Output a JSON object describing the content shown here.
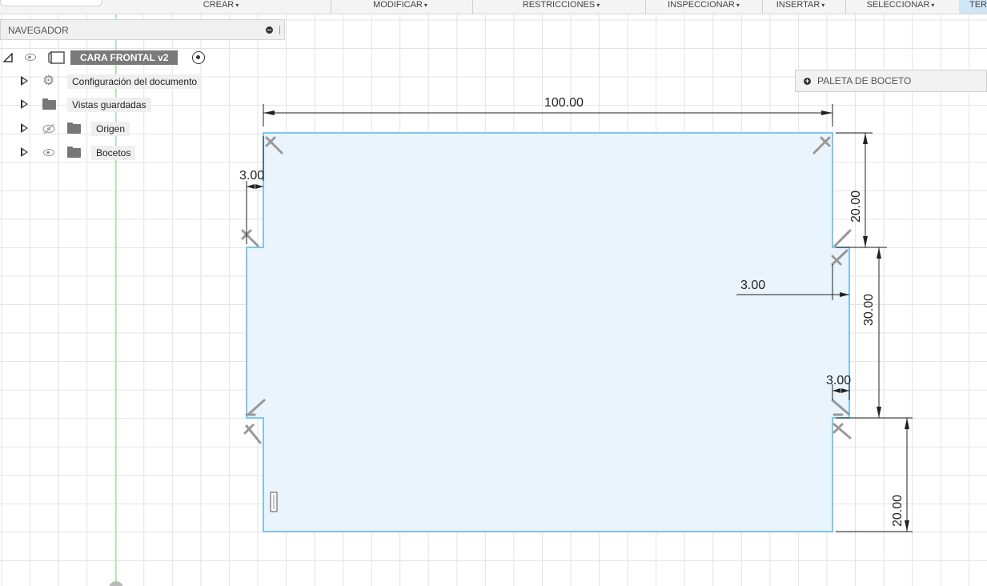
{
  "toolbar": {
    "items": [
      "CREAR",
      "MODIFICAR",
      "RESTRICCIONES",
      "INSPECCIONAR",
      "INSERTAR",
      "SELECCIONAR",
      "TER"
    ],
    "caret": "▾"
  },
  "navigator": {
    "title": "NAVEGADOR",
    "root": {
      "label": "CARA FRONTAL v2"
    },
    "items": [
      {
        "label": "Configuración del documento",
        "icon": "gear-icon"
      },
      {
        "label": "Vistas guardadas",
        "icon": "folder-icon"
      },
      {
        "label": "Origen",
        "icon": "folder-icon",
        "visible": false
      },
      {
        "label": "Bocetos",
        "icon": "folder-icon",
        "visible": true
      }
    ]
  },
  "palette": {
    "label": "PALETA DE BOCETO"
  },
  "dimensions": {
    "width": "100.00",
    "top_right": "20.00",
    "middle_right": "30.00",
    "bottom_right": "20.00",
    "left_notch": "3.00",
    "right_inner": "3.00",
    "right_notch": "3.00"
  },
  "colors": {
    "sketch_fill": "#eaf4fc",
    "sketch_line": "#7ec6ee",
    "grid": "#e3e3e3",
    "axis_green": "#7fdc7f",
    "dimension_line": "#222222",
    "active_tab": "#cfe6f7"
  }
}
